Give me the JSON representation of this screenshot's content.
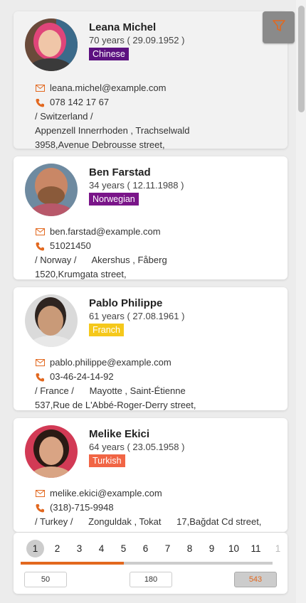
{
  "contacts": [
    {
      "name": "Leana Michel",
      "age": "70 years ( 29.09.1952 )",
      "nationality": "Chinese",
      "badge_color": "#5c1180",
      "email": "leana.michel@example.com",
      "phone": "078 142 17 67",
      "address_line1": "/ Switzerland /",
      "address_line2": "Appenzell Innerrhoden , Trachselwald",
      "address_line3": "3958,Avenue Debrousse street,"
    },
    {
      "name": "Ben Farstad",
      "age": "34 years ( 12.11.1988 )",
      "nationality": "Norwegian",
      "badge_color": "#7a1589",
      "email": "ben.farstad@example.com",
      "phone": "51021450",
      "address_line1": "/ Norway /      Akershus , Fåberg",
      "address_line2": "1520,Krumgata street,"
    },
    {
      "name": "Pablo Philippe",
      "age": "61 years ( 27.08.1961 )",
      "nationality": "Franch",
      "badge_color": "#f5c81b",
      "email": "pablo.philippe@example.com",
      "phone": "03-46-24-14-92",
      "address_line1": "/ France /      Mayotte , Saint-Étienne",
      "address_line2": "537,Rue de L'Abbé-Roger-Derry street,"
    },
    {
      "name": "Melike Ekici",
      "age": "64 years ( 23.05.1958 )",
      "nationality": "Turkish",
      "badge_color": "#f16545",
      "email": "melike.ekici@example.com",
      "phone": "(318)-715-9948",
      "address_line1": "/ Turkey /      Zonguldak , Tokat      17,Bağdat Cd street,"
    }
  ],
  "pagination": {
    "pages": [
      "1",
      "2",
      "3",
      "4",
      "5",
      "6",
      "7",
      "8",
      "9",
      "10",
      "11",
      "1"
    ],
    "active_page": "1",
    "progress_fraction": 0.41,
    "page_sizes": [
      "50",
      "180",
      "543"
    ],
    "selected_page_size": "543"
  },
  "colors": {
    "accent": "#e2681f",
    "filter_button": "#8a8a8a"
  },
  "icons": {
    "filter": "filter-icon",
    "email": "mail-icon",
    "phone": "phone-icon"
  }
}
